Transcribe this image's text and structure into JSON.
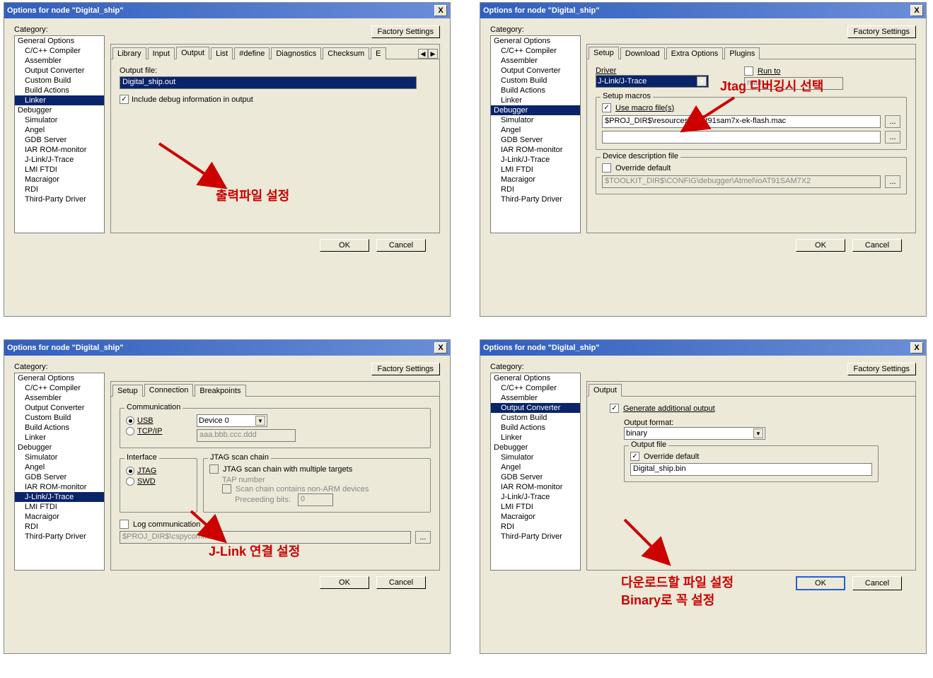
{
  "common": {
    "title": "Options for node \"Digital_ship\"",
    "category_label": "Category:",
    "factory_settings": "Factory Settings",
    "ok": "OK",
    "cancel": "Cancel",
    "close_x": "X",
    "categories": [
      {
        "label": "General Options",
        "indent": false
      },
      {
        "label": "C/C++ Compiler",
        "indent": true
      },
      {
        "label": "Assembler",
        "indent": true
      },
      {
        "label": "Output Converter",
        "indent": true
      },
      {
        "label": "Custom Build",
        "indent": true
      },
      {
        "label": "Build Actions",
        "indent": true
      },
      {
        "label": "Linker",
        "indent": true
      },
      {
        "label": "Debugger",
        "indent": false
      },
      {
        "label": "Simulator",
        "indent": true
      },
      {
        "label": "Angel",
        "indent": true
      },
      {
        "label": "GDB Server",
        "indent": true
      },
      {
        "label": "IAR ROM-monitor",
        "indent": true
      },
      {
        "label": "J-Link/J-Trace",
        "indent": true
      },
      {
        "label": "LMI FTDI",
        "indent": true
      },
      {
        "label": "Macraigor",
        "indent": true
      },
      {
        "label": "RDI",
        "indent": true
      },
      {
        "label": "Third-Party Driver",
        "indent": true
      }
    ]
  },
  "panel1": {
    "selected_category": "Linker",
    "tabs": [
      "Library",
      "Input",
      "Output",
      "List",
      "#define",
      "Diagnostics",
      "Checksum",
      "E"
    ],
    "active_tab": "Output",
    "output_file_label": "Output file:",
    "output_file_value": "Digital_ship.out",
    "include_debug_label": "Include debug information in output",
    "include_debug_checked": true,
    "annotation": "출력파일 설정"
  },
  "panel2": {
    "selected_category": "Debugger",
    "tabs": [
      "Setup",
      "Download",
      "Extra Options",
      "Plugins"
    ],
    "active_tab": "Setup",
    "driver_label": "Driver",
    "driver_value": "J-Link/J-Trace",
    "run_to_label": "Run to",
    "run_to_value": "main",
    "run_to_checked": false,
    "setup_macros_label": "Setup macros",
    "use_macro_label": "Use macro file(s)",
    "use_macro_checked": true,
    "macro_file1": "$PROJ_DIR$\\resources\\iar\\at91sam7x-ek-flash.mac",
    "macro_file2": "",
    "ddf_label": "Device description file",
    "override_default_label": "Override default",
    "override_default_checked": false,
    "ddf_value": "$TOOLKIT_DIR$\\CONFIG\\debugger\\Atmel\\ioAT91SAM7X2",
    "browse": "...",
    "annotation": "Jtag 디버깅시 선택"
  },
  "panel3": {
    "selected_category": "J-Link/J-Trace",
    "tabs": [
      "Setup",
      "Connection",
      "Breakpoints"
    ],
    "active_tab": "Connection",
    "communication_label": "Communication",
    "usb_label": "USB",
    "tcpip_label": "TCP/IP",
    "usb_selected": true,
    "device_value": "Device 0",
    "tcpip_value": "aaa.bbb.ccc.ddd",
    "interface_label": "Interface",
    "jtag_label": "JTAG",
    "swd_label": "SWD",
    "jtag_selected": true,
    "scan_chain_label": "JTAG scan chain",
    "scan_multi_label": "JTAG scan chain with multiple targets",
    "tap_num_label": "TAP number",
    "nonarm_label": "Scan chain contains non-ARM devices",
    "preceding_bits_label": "Preceeding bits:",
    "preceding_bits_value": "0",
    "log_comm_label": "Log communication",
    "log_comm_value": "$PROJ_DIR$\\cspycomm.log",
    "browse": "...",
    "annotation": "J-Link 연결 설정"
  },
  "panel4": {
    "selected_category": "Output Converter",
    "tabs": [
      "Output"
    ],
    "active_tab": "Output",
    "gen_additional_label": "Generate additional output",
    "gen_additional_checked": true,
    "output_format_label": "Output format:",
    "output_format_value": "binary",
    "output_file_group": "Output file",
    "override_label": "Override default",
    "override_checked": true,
    "output_file_value": "Digital_ship.bin",
    "annotation1": "다운로드할 파일 설정",
    "annotation2": "Binary로 꼭 설정"
  }
}
